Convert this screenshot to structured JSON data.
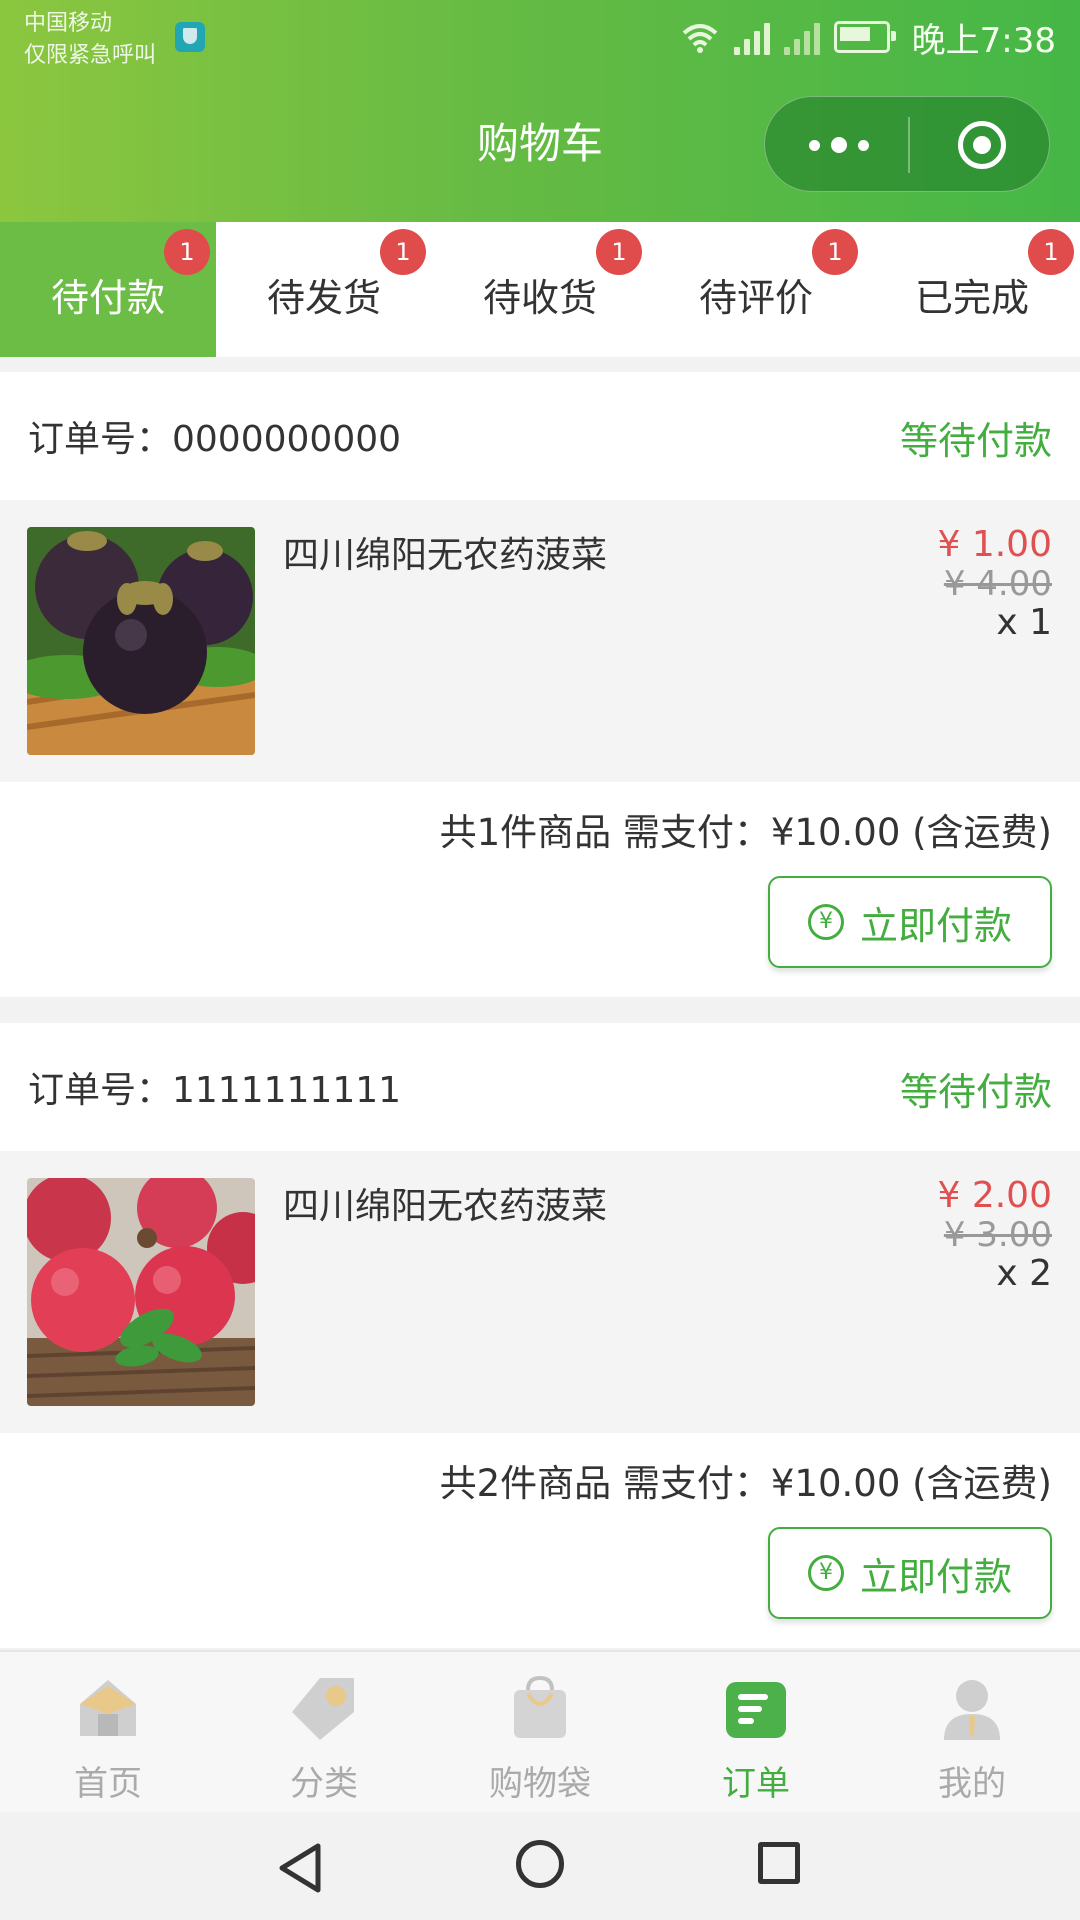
{
  "status_bar": {
    "carrier": "中国移动",
    "emergency": "仅限紧急呼叫",
    "time": "晚上7:38"
  },
  "header": {
    "title": "购物车"
  },
  "tabs": [
    {
      "label": "待付款",
      "badge": "1",
      "active": true
    },
    {
      "label": "待发货",
      "badge": "1"
    },
    {
      "label": "待收货",
      "badge": "1"
    },
    {
      "label": "待评价",
      "badge": "1"
    },
    {
      "label": "已完成",
      "badge": "1"
    }
  ],
  "orders": [
    {
      "order_label": "订单号：0000000000",
      "status": "等待付款",
      "item_name": "四川绵阳无农药菠菜",
      "price": "¥ 1.00",
      "old_price": "¥ 4.00",
      "qty": "x 1",
      "summary": "共1件商品 需支付：¥10.00 (含运费)",
      "pay_label": "立即付款"
    },
    {
      "order_label": "订单号：1111111111",
      "status": "等待付款",
      "item_name": "四川绵阳无农药菠菜",
      "price": "¥ 2.00",
      "old_price": "¥ 3.00",
      "qty": "x 2",
      "summary": "共2件商品 需支付：¥10.00 (含运费)",
      "pay_label": "立即付款"
    }
  ],
  "tabbar": [
    {
      "label": "首页",
      "icon": "home-icon"
    },
    {
      "label": "分类",
      "icon": "tag-icon"
    },
    {
      "label": "购物袋",
      "icon": "bag-icon"
    },
    {
      "label": "订单",
      "icon": "order-icon",
      "active": true
    },
    {
      "label": "我的",
      "icon": "user-icon"
    }
  ],
  "colors": {
    "accent": "#43ad3f",
    "price": "#e05050",
    "badge": "#e04b4b"
  }
}
